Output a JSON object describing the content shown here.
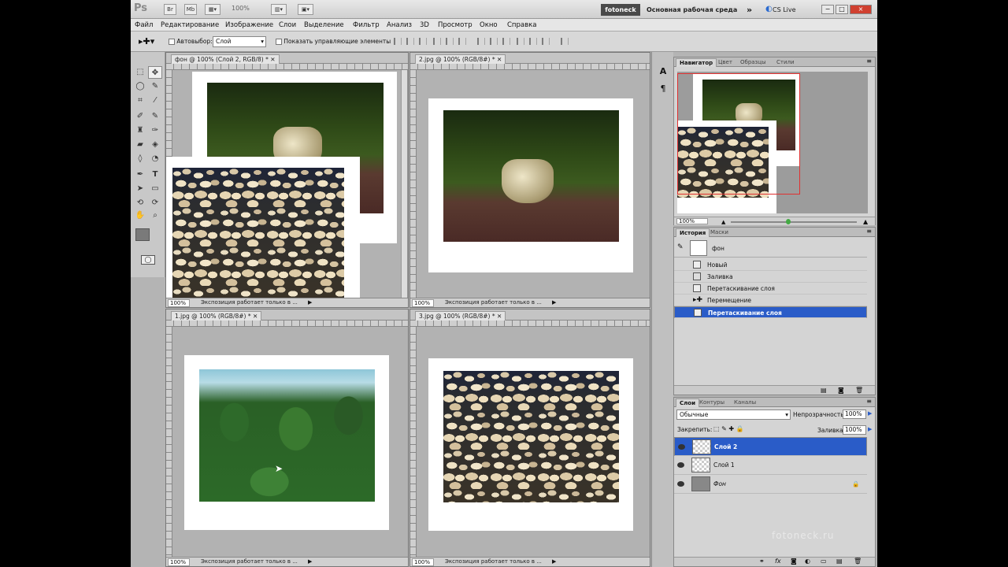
{
  "appbar": {
    "logo": "Ps",
    "bridge": "Br",
    "minibridge": "Mb",
    "zoom": "100%",
    "brand": "fotoneck",
    "workspace": "Основная рабочая среда",
    "workspace_more": "»",
    "cs_live": "CS Live",
    "win_min": "−",
    "win_max": "□",
    "win_close": "×"
  },
  "menu": [
    "Файл",
    "Редактирование",
    "Изображение",
    "Слои",
    "Выделение",
    "Фильтр",
    "Анализ",
    "3D",
    "Просмотр",
    "Окно",
    "Справка"
  ],
  "options": {
    "autoselect": "Автовыбор:",
    "autoselect_value": "Слой",
    "show_controls": "Показать управляющие элементы"
  },
  "docs": [
    {
      "title": "фон @ 100% (Слой 2, RGB/8) *",
      "zoom": "100%",
      "status": "Экспозиция работает только в ..."
    },
    {
      "title": "2.jpg @ 100% (RGB/8#) *",
      "zoom": "100%",
      "status": "Экспозиция работает только в ..."
    },
    {
      "title": "1.jpg @ 100% (RGB/8#) *",
      "zoom": "100%",
      "status": "Экспозиция работает только в ..."
    },
    {
      "title": "3.jpg @ 100% (RGB/8#) *",
      "zoom": "100%",
      "status": "Экспозиция работает только в ..."
    }
  ],
  "navigator": {
    "tabs": [
      "Навигатор",
      "Цвет",
      "Образцы",
      "Стили"
    ],
    "zoom": "100%"
  },
  "history": {
    "tabs": [
      "История",
      "Маски"
    ],
    "snapshot": "фон",
    "items": [
      "Новый",
      "Заливка",
      "Перетаскивание слоя",
      "Перемещение",
      "Перетаскивание слоя"
    ]
  },
  "layers": {
    "tabs": [
      "Слои",
      "Контуры",
      "Каналы"
    ],
    "blend": "Обычные",
    "opacity_label": "Непрозрачность:",
    "opacity": "100%",
    "lock_label": "Закрепить:",
    "fill_label": "Заливка:",
    "fill": "100%",
    "rows": [
      "Слой 2",
      "Слой 1",
      "Фон"
    ]
  },
  "watermark": "fotoneck.ru"
}
